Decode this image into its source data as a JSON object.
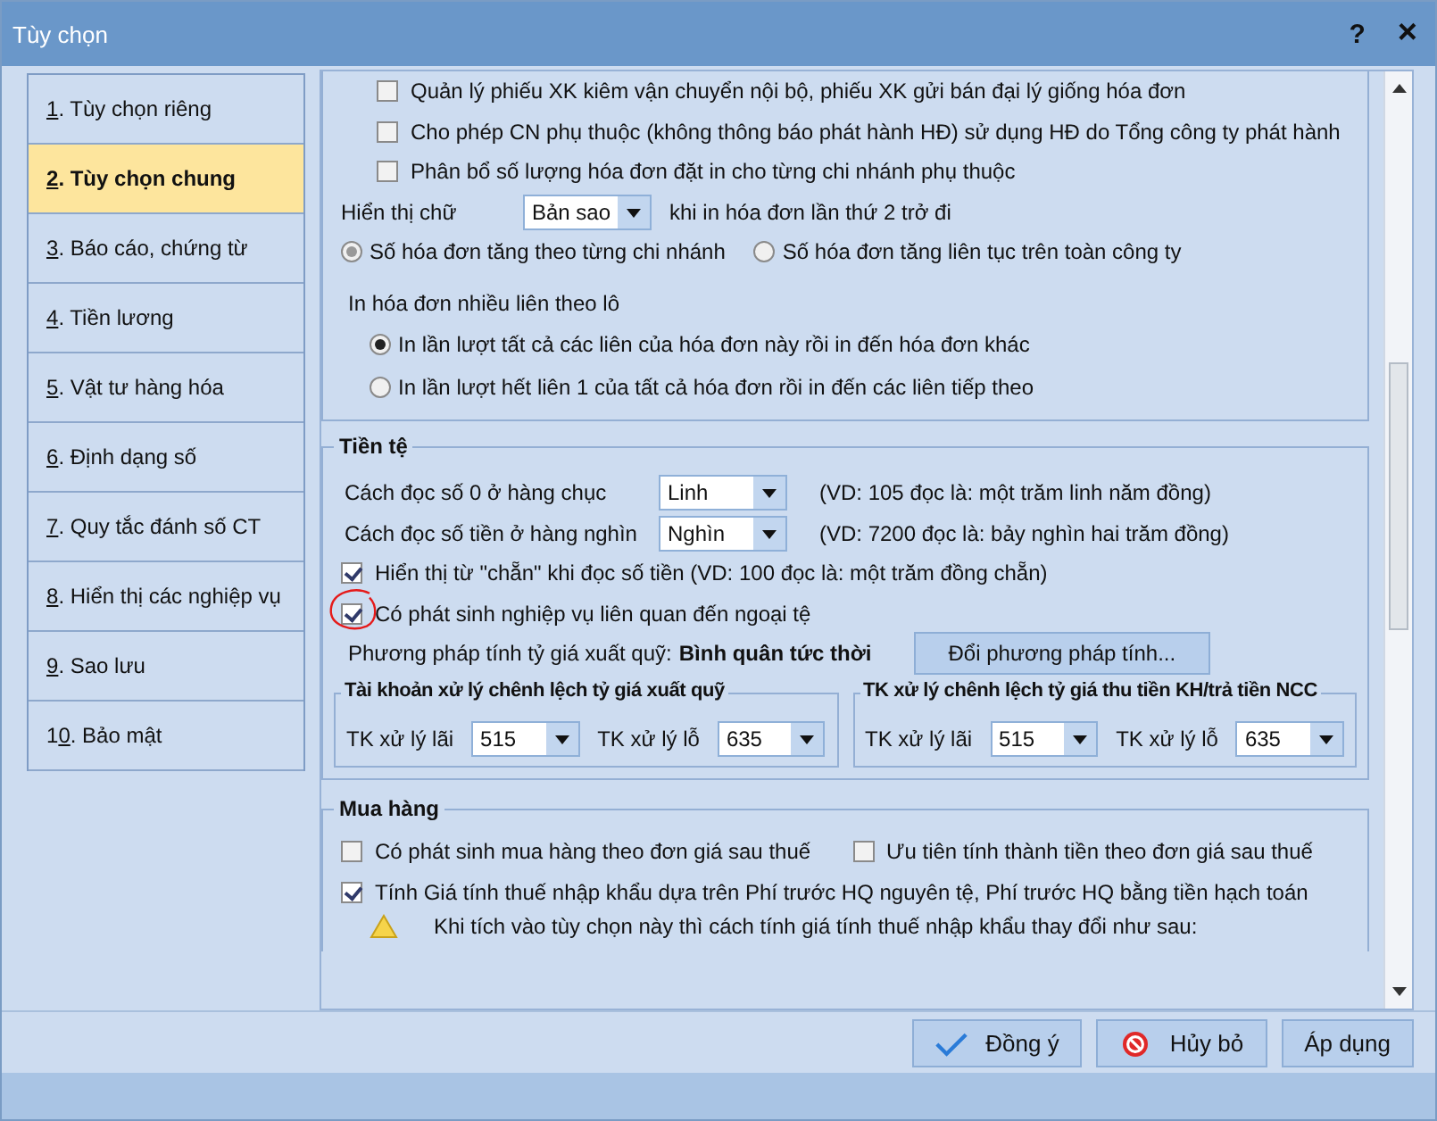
{
  "window": {
    "title": "Tùy chọn",
    "help": "?",
    "close": "×"
  },
  "sidebar": {
    "items": [
      {
        "hotkey": "1",
        "rest": ". Tùy chọn riêng",
        "selected": false
      },
      {
        "hotkey": "2",
        "rest": ". Tùy chọn chung",
        "selected": true
      },
      {
        "hotkey": "3",
        "rest": ". Báo cáo, chứng từ",
        "selected": false
      },
      {
        "hotkey": "4",
        "rest": ". Tiền lương",
        "selected": false
      },
      {
        "hotkey": "5",
        "rest": ". Vật tư hàng hóa",
        "selected": false
      },
      {
        "hotkey": "6",
        "rest": ". Định dạng số",
        "selected": false
      },
      {
        "hotkey": "7",
        "rest": ". Quy tắc đánh số CT",
        "selected": false
      },
      {
        "hotkey": "8",
        "rest": ". Hiển thị các nghiệp vụ",
        "selected": false
      },
      {
        "hotkey": "9",
        "rest": ". Sao lưu",
        "selected": false
      },
      {
        "prefix": "1",
        "hotkey": "0",
        "rest": ". Bảo mật",
        "selected": false
      }
    ]
  },
  "invoice_options": {
    "checkboxes": [
      {
        "label": "Quản lý phiếu XK kiêm vận chuyển nội bộ, phiếu XK gửi bán đại lý giống hóa đơn",
        "checked": false
      },
      {
        "label": "Cho phép CN phụ thuộc (không thông báo phát hành HĐ) sử dụng HĐ do Tổng công ty phát hành",
        "checked": false
      },
      {
        "label": "Phân bổ số lượng hóa đơn đặt in cho từng chi nhánh phụ thuộc",
        "checked": false
      }
    ],
    "display_text": {
      "label": "Hiển thị chữ",
      "value": "Bản sao",
      "suffix": "khi in hóa đơn lần thứ 2 trở đi"
    },
    "numbering": [
      {
        "label": "Số hóa đơn tăng theo từng chi nhánh",
        "selected": true
      },
      {
        "label": "Số hóa đơn tăng liên tục trên toàn công ty",
        "selected": false
      }
    ],
    "batch_print": {
      "label": "In hóa đơn nhiều liên theo lô",
      "options": [
        {
          "label": "In lần lượt tất cả các liên của hóa đơn này rồi in đến hóa đơn khác",
          "selected": true
        },
        {
          "label": "In lần lượt hết liên 1 của tất cả hóa đơn rồi in đến các liên tiếp theo",
          "selected": false
        }
      ]
    }
  },
  "currency": {
    "title": "Tiền tệ",
    "reading": [
      {
        "label": "Cách đọc số 0 ở hàng chục",
        "value": "Linh",
        "example": "(VD: 105 đọc là: một trăm linh năm đồng)"
      },
      {
        "label": "Cách đọc số tiền ở hàng nghìn",
        "value": "Nghìn",
        "example": "(VD: 7200 đọc là: bảy nghìn hai trăm đồng)"
      }
    ],
    "checkboxes": [
      {
        "label": "Hiển thị từ \"chẵn\" khi đọc số tiền (VD: 100 đọc là: một trăm đồng chẵn)",
        "checked": true,
        "circled": false
      },
      {
        "label": "Có phát sinh nghiệp vụ liên quan đến ngoại tệ",
        "checked": true,
        "circled": true
      }
    ],
    "rate_method": {
      "label": "Phương pháp tính tỷ giá xuất quỹ:",
      "value": "Bình quân tức thời",
      "button": "Đổi phương pháp tính..."
    },
    "account_groups": [
      {
        "title": "Tài khoản xử lý chênh lệch tỷ giá xuất quỹ",
        "fields": [
          {
            "label": "TK xử lý lãi",
            "value": "515"
          },
          {
            "label": "TK xử lý lỗ",
            "value": "635"
          }
        ]
      },
      {
        "title": "TK xử lý chênh lệch tỷ giá thu tiền KH/trả tiền NCC",
        "fields": [
          {
            "label": "TK xử lý lãi",
            "value": "515"
          },
          {
            "label": "TK xử lý lỗ",
            "value": "635"
          }
        ]
      }
    ]
  },
  "purchasing": {
    "title": "Mua hàng",
    "row_checkboxes": [
      {
        "label": "Có phát sinh mua hàng theo đơn giá sau thuế",
        "checked": false
      },
      {
        "label": "Ưu tiên tính thành tiền theo đơn giá sau thuế",
        "checked": false
      }
    ],
    "import_tax": {
      "label": "Tính Giá tính thuế nhập khẩu dựa trên Phí trước HQ nguyên tệ, Phí trước HQ bằng tiền hạch toán",
      "checked": true
    },
    "warning": "Khi tích vào tùy chọn này thì cách tính giá tính thuế nhập khẩu thay đổi như sau:"
  },
  "buttons": [
    {
      "label": "Đồng ý",
      "kind": "ok"
    },
    {
      "label": "Hủy bỏ",
      "kind": "cancel"
    },
    {
      "label": "Áp dụng",
      "kind": "apply"
    }
  ]
}
